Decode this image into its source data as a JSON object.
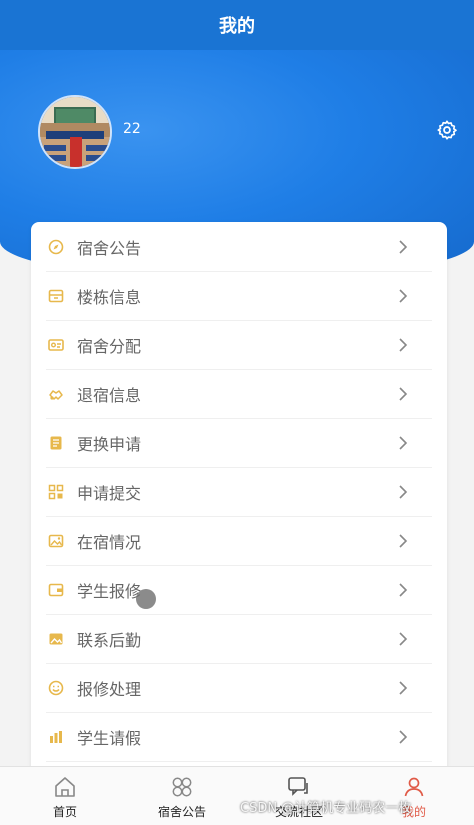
{
  "header": {
    "title": "我的"
  },
  "profile": {
    "username": "22",
    "avatar_icon": "dormitory-photo",
    "settings_icon": "gear-icon"
  },
  "menu": [
    {
      "label": "宿舍公告",
      "icon": "compass-icon"
    },
    {
      "label": "楼栋信息",
      "icon": "box-icon"
    },
    {
      "label": "宿舍分配",
      "icon": "card-icon"
    },
    {
      "label": "退宿信息",
      "icon": "handshake-icon"
    },
    {
      "label": "更换申请",
      "icon": "document-icon"
    },
    {
      "label": "申请提交",
      "icon": "grid-icon"
    },
    {
      "label": "在宿情况",
      "icon": "picture-icon"
    },
    {
      "label": "学生报修",
      "icon": "wallet-icon"
    },
    {
      "label": "联系后勤",
      "icon": "picture-icon"
    },
    {
      "label": "报修处理",
      "icon": "smile-icon"
    },
    {
      "label": "学生请假",
      "icon": "bar-chart-icon"
    }
  ],
  "tabs": [
    {
      "label": "首页",
      "icon": "home-icon"
    },
    {
      "label": "宿舍公告",
      "icon": "clover-icon"
    },
    {
      "label": "交流社区",
      "icon": "chat-icon"
    },
    {
      "label": "我的",
      "icon": "user-icon"
    }
  ],
  "active_tab": 3,
  "watermark": "CSDN @计算机专业码农一枚",
  "colors": {
    "primary": "#1a74d3",
    "icon_gold": "#e7b84c",
    "active_tab": "#e05a47"
  }
}
